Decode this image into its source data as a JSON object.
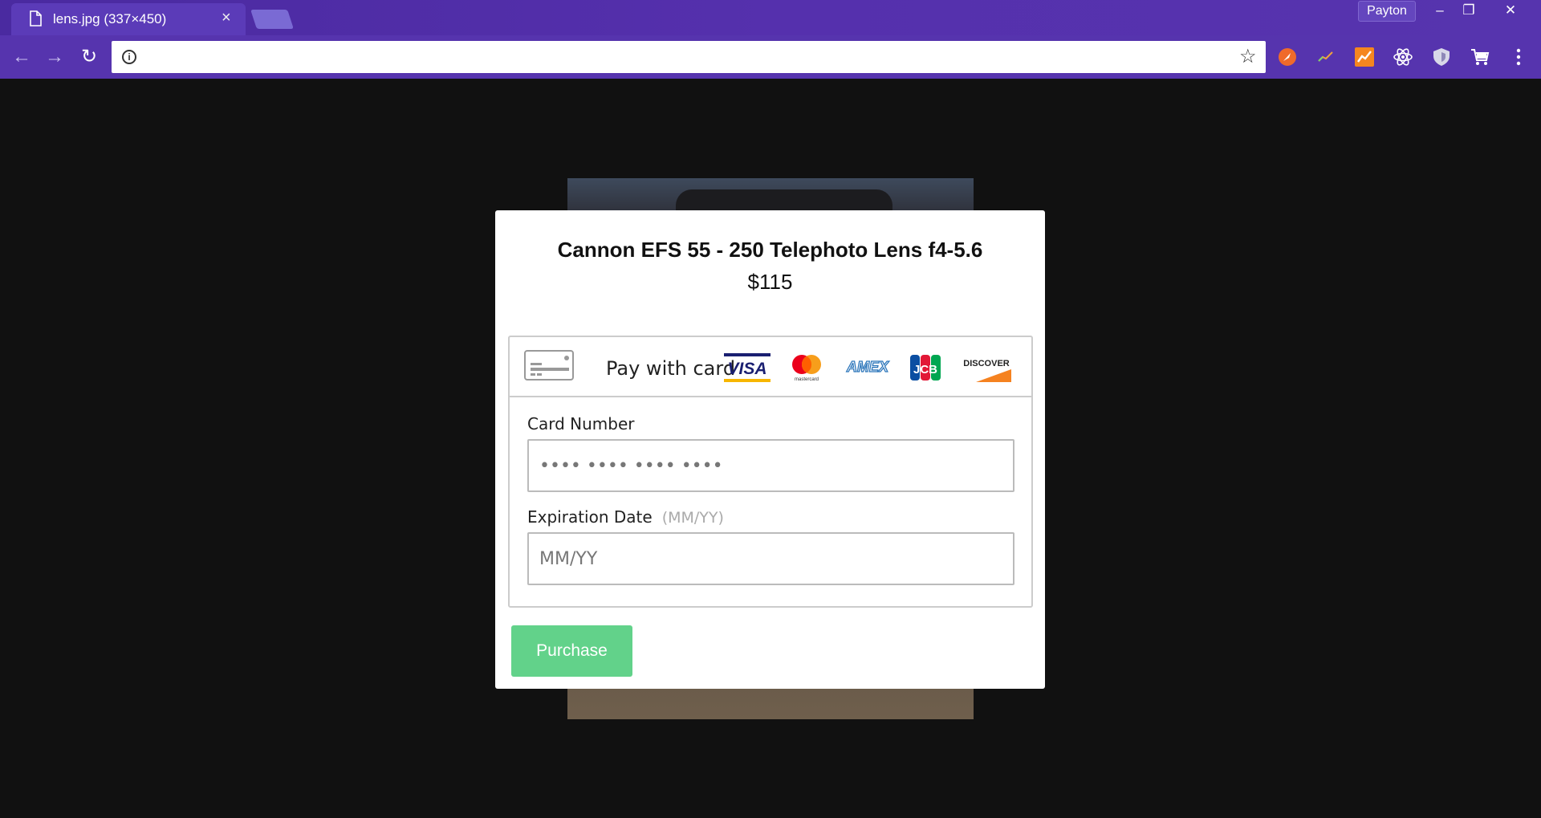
{
  "browser": {
    "tab_title": "lens.jpg (337×450)",
    "tab_close": "×",
    "profile_name": "Payton",
    "window_controls": {
      "minimize": "–",
      "restore": "❐",
      "close": "✕"
    },
    "nav": {
      "back": "←",
      "forward": "→",
      "reload": "↻"
    },
    "url_value": "",
    "info_icon": "i",
    "star_icon": "☆",
    "extensions": [
      "rocket-extension-icon",
      "sparkline-extension-icon",
      "chart-extension-icon",
      "react-devtools-icon",
      "shield-extension-icon",
      "cart-extension-icon",
      "menu-dots-icon"
    ],
    "accent_color": "#5634ae"
  },
  "modal": {
    "product_title": "Cannon EFS 55 - 250 Telephoto Lens f4-5.6",
    "price": "$115",
    "pay_with_card": "Pay with card",
    "card_brands": [
      "VISA",
      "mastercard",
      "AMEX",
      "JCB",
      "DISCOVER"
    ],
    "card_number_label": "Card Number",
    "card_number_placeholder": "•••• •••• •••• ••••",
    "expiration_label": "Expiration Date",
    "expiration_hint": "(MM/YY)",
    "expiration_placeholder": "MM/YY",
    "purchase_label": "Purchase",
    "purchase_color": "#62d28a"
  }
}
